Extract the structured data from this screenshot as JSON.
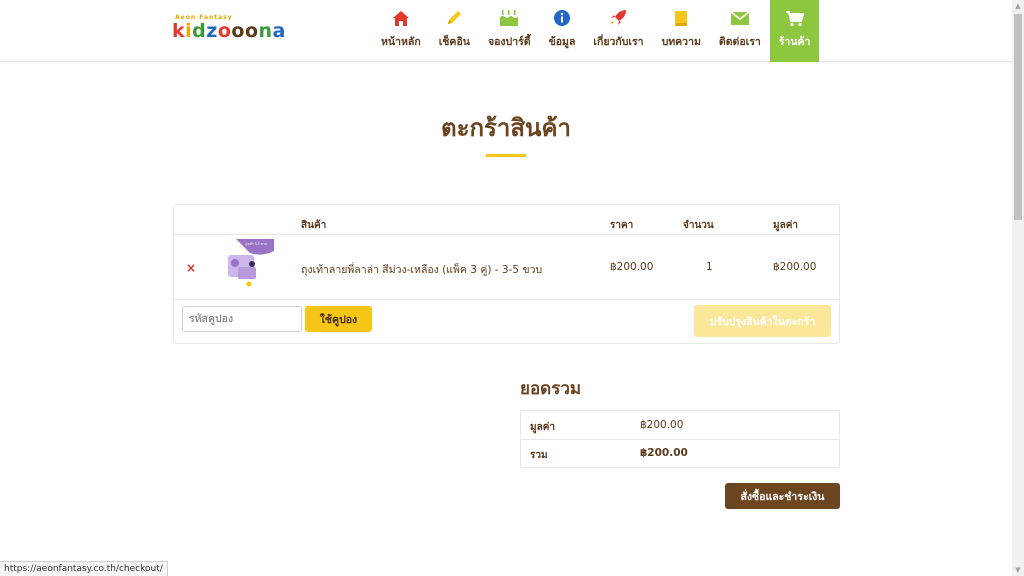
{
  "logo": {
    "tagline": "Aeon Fantasy",
    "letters": [
      {
        "ch": "k",
        "color": "#e23a2e"
      },
      {
        "ch": "i",
        "color": "#f5a500"
      },
      {
        "ch": "d",
        "color": "#3a9a3a"
      },
      {
        "ch": "z",
        "color": "#2266c4"
      },
      {
        "ch": "o",
        "color": "#e23a2e"
      },
      {
        "ch": "o",
        "color": "#5b3a1a"
      },
      {
        "ch": "o",
        "color": "#5b3a1a"
      },
      {
        "ch": "n",
        "color": "#3a9a3a"
      },
      {
        "ch": "a",
        "color": "#2266c4"
      }
    ]
  },
  "nav": [
    {
      "label": "หน้าหลัก",
      "icon": "home-icon",
      "color": "#e23a2e",
      "active": false
    },
    {
      "label": "เช็คอิน",
      "icon": "pencil-icon",
      "color": "#f5c518",
      "active": false
    },
    {
      "label": "จองปาร์ตี้",
      "icon": "cake-icon",
      "color": "#8dc63f",
      "active": false
    },
    {
      "label": "ข้อมูล",
      "icon": "info-icon",
      "color": "#2266c4",
      "active": false
    },
    {
      "label": "เกี่ยวกับเรา",
      "icon": "rocket-icon",
      "color": "#e23a2e",
      "active": false
    },
    {
      "label": "บทความ",
      "icon": "book-icon",
      "color": "#f5c518",
      "active": false
    },
    {
      "label": "ติดต่อเรา",
      "icon": "envelope-icon",
      "color": "#8dc63f",
      "active": false
    },
    {
      "label": "ร้านค้า",
      "icon": "cart-icon",
      "color": "#ffffff",
      "active": true
    }
  ],
  "page": {
    "title": "ตะกร้าสินค้า"
  },
  "cart": {
    "headers": {
      "product": "สินค้า",
      "price": "ราคา",
      "quantity": "จำนวน",
      "subtotal": "มูลค่า"
    },
    "items": [
      {
        "remove_symbol": "×",
        "name": "ถุงเท้าลายพี่ลาล่า สีม่วง-เหลือง (แพ็ค 3 คู่) - 3-5 ขวบ",
        "price": "฿200.00",
        "quantity": "1",
        "subtotal": "฿200.00",
        "thumb_text": "ถุงเท้า 3-5 ขวบ"
      }
    ],
    "coupon_placeholder": "รหัสคูปอง",
    "apply_coupon_label": "ใช้คูปอง",
    "update_cart_label": "ปรับปรุงสินค้าในตะกร้า"
  },
  "totals": {
    "title": "ยอดรวม",
    "subtotal_label": "มูลค่า",
    "subtotal_value": "฿200.00",
    "total_label": "รวม",
    "total_value": "฿200.00",
    "checkout_label": "สั่งซื้อและชำระเงิน"
  },
  "status_url": "https://aeonfantasy.co.th/checkout/",
  "colors": {
    "accent_green": "#8dc63f",
    "accent_yellow": "#f5c518",
    "brown": "#6b4420",
    "remove_red": "#d0342c"
  }
}
